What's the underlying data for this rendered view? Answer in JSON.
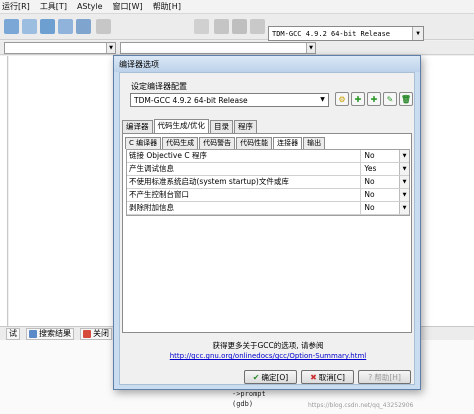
{
  "menubar": {
    "items": [
      "运行[R]",
      "工具[T]",
      "AStyle",
      "窗口[W]",
      "帮助[H]"
    ]
  },
  "toolbar": {
    "compiler": "TDM-GCC 4.9.2 64-bit Release"
  },
  "bottom_tabs": [
    "试",
    "搜索结果",
    "关闭"
  ],
  "log": {
    "line1": "(gdb)",
    "line2": "->prompt"
  },
  "watermark": "https://blog.csdn.net/qq_43252906",
  "dialog": {
    "title": "编译器选项",
    "set_label": "设定编译器配置",
    "set_value": "TDM-GCC 4.9.2 64-bit Release",
    "tabs": [
      "编译器",
      "代码生成/优化",
      "目录",
      "程序"
    ],
    "subtabs": [
      "C 编译器",
      "代码生成",
      "代码警告",
      "代码性能",
      "连接器",
      "输出"
    ],
    "rows": [
      {
        "label": "链接 Objective C 程序",
        "value": "No"
      },
      {
        "label": "产生调试信息",
        "value": "Yes"
      },
      {
        "label": "不使用标准系统启动(system startup)文件或库",
        "value": "No"
      },
      {
        "label": "不产生控制台窗口",
        "value": "No"
      },
      {
        "label": "剥除附加信息",
        "value": "No"
      }
    ],
    "info": "获得更多关于GCC的选项, 请参阅",
    "link": "http://gcc.gnu.org/onlinedocs/gcc/Option-Summary.html",
    "ok": "确定[O]",
    "cancel": "取消[C]",
    "help": "帮助[H]"
  }
}
